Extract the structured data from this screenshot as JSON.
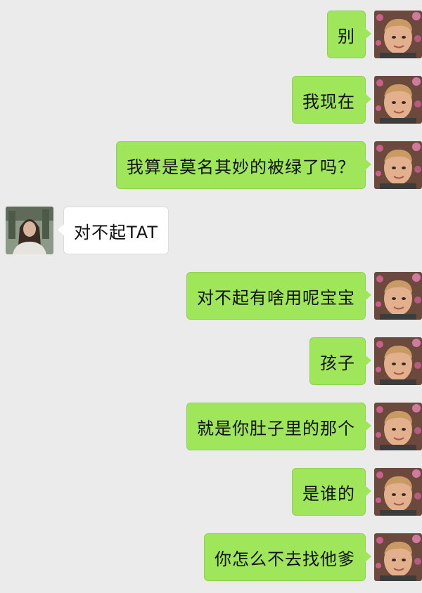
{
  "conversation": {
    "messages": [
      {
        "side": "right",
        "text": "别",
        "avatar_icon": "boy-avatar-icon"
      },
      {
        "side": "right",
        "text": "我现在",
        "avatar_icon": "boy-avatar-icon"
      },
      {
        "side": "right",
        "text": "我算是莫名其妙的被绿了吗？",
        "avatar_icon": "boy-avatar-icon"
      },
      {
        "side": "left",
        "text": "对不起TAT",
        "avatar_icon": "girl-avatar-icon"
      },
      {
        "side": "right",
        "text": "对不起有啥用呢宝宝",
        "avatar_icon": "boy-avatar-icon"
      },
      {
        "side": "right",
        "text": "孩子",
        "avatar_icon": "boy-avatar-icon"
      },
      {
        "side": "right",
        "text": "就是你肚子里的那个",
        "avatar_icon": "boy-avatar-icon"
      },
      {
        "side": "right",
        "text": "是谁的",
        "avatar_icon": "boy-avatar-icon"
      },
      {
        "side": "right",
        "text": "你怎么不去找他爹",
        "avatar_icon": "boy-avatar-icon"
      }
    ]
  },
  "colors": {
    "background": "#ebebeb",
    "sent_bubble": "#9fe65b",
    "received_bubble": "#ffffff"
  }
}
